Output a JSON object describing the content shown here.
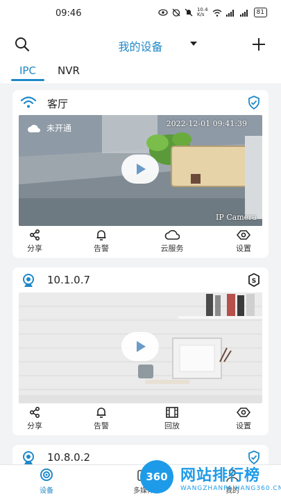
{
  "status_bar": {
    "time": "09:46",
    "network_speed": "10.4\nK/s",
    "battery": "81"
  },
  "header": {
    "title": "我的设备"
  },
  "tabs": [
    {
      "label": "IPC",
      "active": true
    },
    {
      "label": "NVR",
      "active": false
    }
  ],
  "devices": [
    {
      "name": "客厅",
      "cloud_status": "未开通",
      "timestamp_overlay": "2022-12-01 09:41:39",
      "camera_overlay": "IP Camera",
      "actions": [
        {
          "label": "分享",
          "icon": "share-icon"
        },
        {
          "label": "告警",
          "icon": "bell-icon"
        },
        {
          "label": "云服务",
          "icon": "cloud-icon"
        },
        {
          "label": "设置",
          "icon": "settings-eye-icon"
        }
      ]
    },
    {
      "name": "10.1.0.7",
      "actions": [
        {
          "label": "分享",
          "icon": "share-icon"
        },
        {
          "label": "告警",
          "icon": "bell-icon"
        },
        {
          "label": "回放",
          "icon": "film-icon"
        },
        {
          "label": "设置",
          "icon": "settings-eye-icon"
        }
      ]
    },
    {
      "name": "10.8.0.2"
    }
  ],
  "bottom_nav": [
    {
      "label": "设备",
      "active": true
    },
    {
      "label": "多媒体",
      "active": false
    },
    {
      "label": "我的",
      "active": false
    }
  ],
  "watermark": {
    "logo": "360",
    "text": "网站排行榜",
    "url": "WANGZHANPAIHANG360.CN"
  },
  "colors": {
    "accent": "#1e88c8",
    "watermark": "#1e9be8"
  }
}
